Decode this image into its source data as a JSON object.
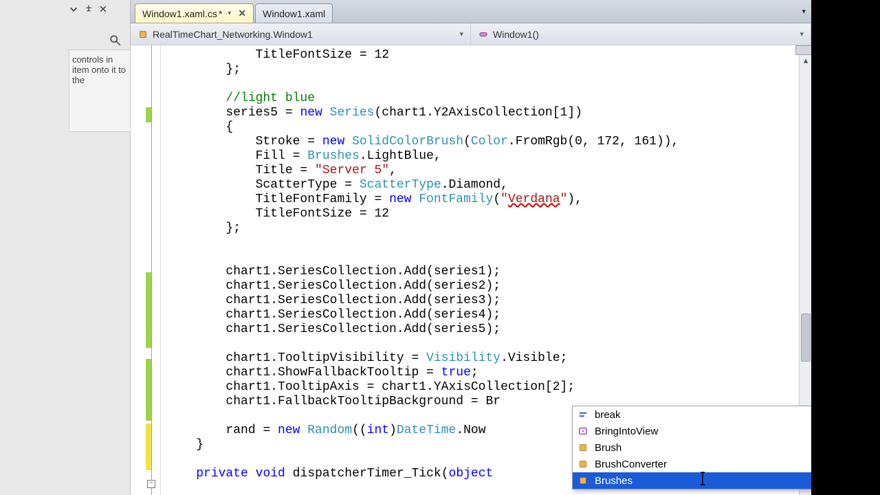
{
  "left": {
    "help_text": "controls in\n item onto\nit to the"
  },
  "tabs": {
    "active": {
      "label": "Window1.xaml.cs",
      "dirty": "*"
    },
    "other": {
      "label": "Window1.xaml"
    }
  },
  "nav": {
    "left": "RealTimeChart_Networking.Window1",
    "right": "Window1()"
  },
  "code": {
    "l1": "            TitleFontSize = 12",
    "l2": "        };",
    "l3": "",
    "cmt": "        //light blue",
    "l5a": "        series5 = ",
    "l5b": "new",
    "l5c": " ",
    "l5d": "Series",
    "l5e": "(chart1.Y2AxisCollection[1])",
    "l6": "        {",
    "l7a": "            Stroke = ",
    "l7b": "new",
    "l7c": " ",
    "l7d": "SolidColorBrush",
    "l7e": "(",
    "l7f": "Color",
    "l7g": ".FromRgb(0, 172, 161)),",
    "l8a": "            Fill = ",
    "l8b": "Brushes",
    "l8c": ".LightBlue,",
    "l9a": "            Title = ",
    "l9b": "\"Server 5\"",
    "l9c": ",",
    "l10a": "            ScatterType = ",
    "l10b": "ScatterType",
    "l10c": ".Diamond,",
    "l11a": "            TitleFontFamily = ",
    "l11b": "new",
    "l11c": " ",
    "l11d": "FontFamily",
    "l11e": "(",
    "l11f": "\"",
    "l11g": "Verdana",
    "l11h": "\"",
    "l11i": "),",
    "l12": "            TitleFontSize = 12",
    "l13": "        };",
    "l14": "",
    "l15": "",
    "l16": "        chart1.SeriesCollection.Add(series1);",
    "l17": "        chart1.SeriesCollection.Add(series2);",
    "l18": "        chart1.SeriesCollection.Add(series3);",
    "l19": "        chart1.SeriesCollection.Add(series4);",
    "l20": "        chart1.SeriesCollection.Add(series5);",
    "l21": "",
    "l22a": "        chart1.TooltipVisibility = ",
    "l22b": "Visibility",
    "l22c": ".Visible;",
    "l23a": "        chart1.ShowFallbackTooltip = ",
    "l23b": "true",
    "l23c": ";",
    "l24": "        chart1.TooltipAxis = chart1.YAxisCollection[2];",
    "l25": "        chart1.FallbackTooltipBackground = Br",
    "l26": "",
    "l27a": "        rand = ",
    "l27b": "new",
    "l27c": " ",
    "l27d": "Random",
    "l27e": "((",
    "l27f": "int",
    "l27g": ")",
    "l27h": "DateTime",
    "l27i": ".Now",
    "l28": "    }",
    "l29": "",
    "l30a": "    ",
    "l30b": "private",
    "l30c": " ",
    "l30d": "void",
    "l30e": " dispatcherTimer_Tick(",
    "l30f": "object"
  },
  "intellisense": {
    "items": [
      {
        "label": "break",
        "kind": "keyword"
      },
      {
        "label": "BringIntoView",
        "kind": "method"
      },
      {
        "label": "Brush",
        "kind": "class"
      },
      {
        "label": "BrushConverter",
        "kind": "class"
      },
      {
        "label": "Brushes",
        "kind": "class",
        "selected": true
      }
    ]
  }
}
